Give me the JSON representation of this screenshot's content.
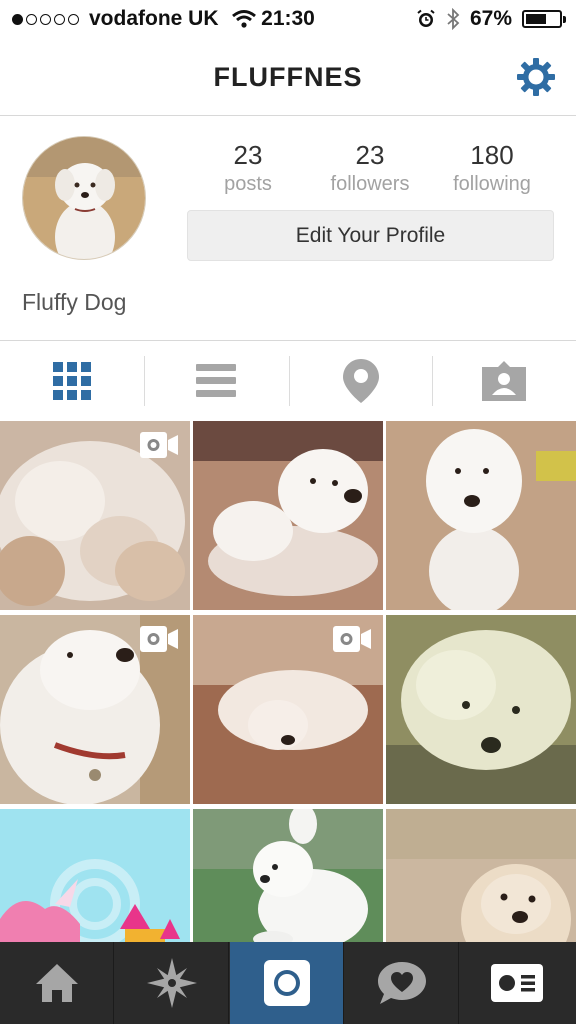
{
  "status_bar": {
    "signal_filled": 1,
    "signal_total": 5,
    "carrier": "vodafone UK",
    "time": "21:30",
    "battery_percent": "67%",
    "battery_level": 0.67
  },
  "nav": {
    "title": "FLUFFNES",
    "settings_icon": "gear-icon"
  },
  "profile": {
    "full_name": "Fluffy Dog",
    "stats": [
      {
        "value": "23",
        "label": "posts"
      },
      {
        "value": "23",
        "label": "followers"
      },
      {
        "value": "180",
        "label": "following"
      }
    ],
    "edit_button": "Edit Your Profile"
  },
  "view_tabs": [
    {
      "icon": "grid-icon",
      "active": true
    },
    {
      "icon": "list-icon",
      "active": false
    },
    {
      "icon": "map-pin-icon",
      "active": false
    },
    {
      "icon": "tagged-photos-icon",
      "active": false
    }
  ],
  "photos": [
    {
      "subject": "dog-closeup",
      "video": true
    },
    {
      "subject": "dog-lying",
      "video": false
    },
    {
      "subject": "dog-sitting",
      "video": false
    },
    {
      "subject": "dog-profile",
      "video": true
    },
    {
      "subject": "dog-sleeping",
      "video": true
    },
    {
      "subject": "dog-vintage",
      "video": false
    },
    {
      "subject": "unicorn-castle",
      "video": false
    },
    {
      "subject": "dog-running-grass",
      "video": false
    },
    {
      "subject": "dog-fluffy",
      "video": false
    }
  ],
  "tab_bar": [
    {
      "icon": "home-icon",
      "active": false
    },
    {
      "icon": "explore-icon",
      "active": false
    },
    {
      "icon": "camera-icon",
      "active": true
    },
    {
      "icon": "activity-icon",
      "active": false
    },
    {
      "icon": "profile-card-icon",
      "active": false
    }
  ],
  "colors": {
    "accent_blue": "#2f6da4",
    "tabbar_bg": "#2a2a2a",
    "tabbar_active": "#2f5f8c",
    "inactive_icon": "#a6a6a6"
  }
}
